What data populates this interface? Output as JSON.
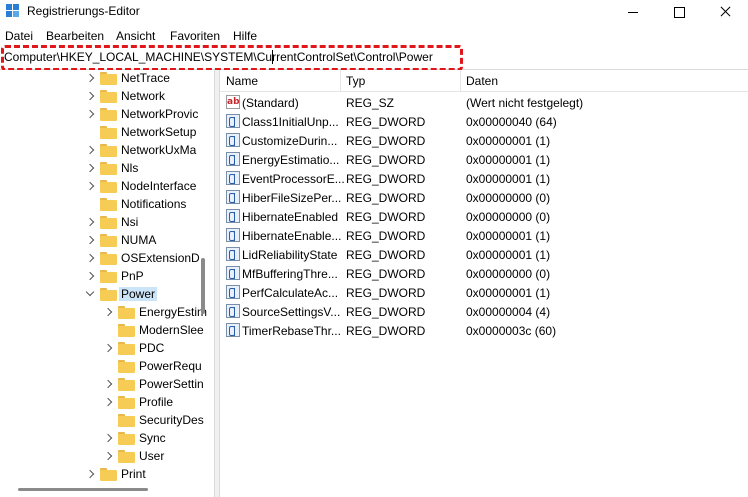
{
  "window": {
    "title": "Registrierungs-Editor"
  },
  "menu": [
    "Datei",
    "Bearbeiten",
    "Ansicht",
    "Favoriten",
    "Hilfe"
  ],
  "address": "Computer\\HKEY_LOCAL_MACHINE\\SYSTEM\\CurrentControlSet\\Control\\Power",
  "tree": [
    {
      "label": "NetTrace",
      "level": 1,
      "state": "collapsed"
    },
    {
      "label": "Network",
      "level": 1,
      "state": "collapsed"
    },
    {
      "label": "NetworkProvic",
      "level": 1,
      "state": "collapsed"
    },
    {
      "label": "NetworkSetup",
      "level": 1,
      "state": "none"
    },
    {
      "label": "NetworkUxMa",
      "level": 1,
      "state": "collapsed"
    },
    {
      "label": "Nls",
      "level": 1,
      "state": "collapsed"
    },
    {
      "label": "NodeInterface",
      "level": 1,
      "state": "collapsed"
    },
    {
      "label": "Notifications",
      "level": 1,
      "state": "none"
    },
    {
      "label": "Nsi",
      "level": 1,
      "state": "collapsed"
    },
    {
      "label": "NUMA",
      "level": 1,
      "state": "collapsed"
    },
    {
      "label": "OSExtensionD",
      "level": 1,
      "state": "collapsed"
    },
    {
      "label": "PnP",
      "level": 1,
      "state": "collapsed"
    },
    {
      "label": "Power",
      "level": 1,
      "state": "expanded",
      "selected": true
    },
    {
      "label": "EnergyEstim",
      "level": 2,
      "state": "collapsed"
    },
    {
      "label": "ModernSlee",
      "level": 2,
      "state": "none"
    },
    {
      "label": "PDC",
      "level": 2,
      "state": "collapsed"
    },
    {
      "label": "PowerRequ",
      "level": 2,
      "state": "none"
    },
    {
      "label": "PowerSettin",
      "level": 2,
      "state": "collapsed"
    },
    {
      "label": "Profile",
      "level": 2,
      "state": "collapsed"
    },
    {
      "label": "SecurityDes",
      "level": 2,
      "state": "none"
    },
    {
      "label": "Sync",
      "level": 2,
      "state": "collapsed"
    },
    {
      "label": "User",
      "level": 2,
      "state": "collapsed"
    },
    {
      "label": "Print",
      "level": 1,
      "state": "collapsed"
    }
  ],
  "columns": {
    "name": "Name",
    "type": "Typ",
    "data": "Daten"
  },
  "values": [
    {
      "name": "(Standard)",
      "type": "REG_SZ",
      "data": "(Wert nicht festgelegt)",
      "icon": "string-value-icon"
    },
    {
      "name": "Class1InitialUnp...",
      "type": "REG_DWORD",
      "data": "0x00000040 (64)",
      "icon": "dword-value-icon"
    },
    {
      "name": "CustomizeDurin...",
      "type": "REG_DWORD",
      "data": "0x00000001 (1)",
      "icon": "dword-value-icon"
    },
    {
      "name": "EnergyEstimatio...",
      "type": "REG_DWORD",
      "data": "0x00000001 (1)",
      "icon": "dword-value-icon"
    },
    {
      "name": "EventProcessorE...",
      "type": "REG_DWORD",
      "data": "0x00000001 (1)",
      "icon": "dword-value-icon"
    },
    {
      "name": "HiberFileSizePer...",
      "type": "REG_DWORD",
      "data": "0x00000000 (0)",
      "icon": "dword-value-icon"
    },
    {
      "name": "HibernateEnabled",
      "type": "REG_DWORD",
      "data": "0x00000000 (0)",
      "icon": "dword-value-icon"
    },
    {
      "name": "HibernateEnable...",
      "type": "REG_DWORD",
      "data": "0x00000001 (1)",
      "icon": "dword-value-icon"
    },
    {
      "name": "LidReliabilityState",
      "type": "REG_DWORD",
      "data": "0x00000001 (1)",
      "icon": "dword-value-icon"
    },
    {
      "name": "MfBufferingThre...",
      "type": "REG_DWORD",
      "data": "0x00000000 (0)",
      "icon": "dword-value-icon"
    },
    {
      "name": "PerfCalculateAc...",
      "type": "REG_DWORD",
      "data": "0x00000001 (1)",
      "icon": "dword-value-icon"
    },
    {
      "name": "SourceSettingsV...",
      "type": "REG_DWORD",
      "data": "0x00000004 (4)",
      "icon": "dword-value-icon"
    },
    {
      "name": "TimerRebaseThr...",
      "type": "REG_DWORD",
      "data": "0x0000003c (60)",
      "icon": "dword-value-icon"
    }
  ],
  "colors": {
    "highlight": "#e0161b",
    "selection": "#cce4f7",
    "folder": "#f7cc55"
  }
}
